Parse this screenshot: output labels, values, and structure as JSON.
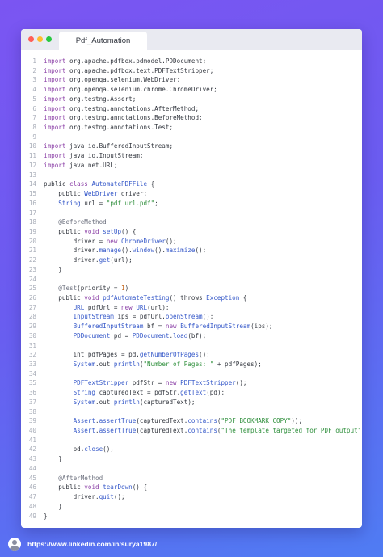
{
  "window": {
    "tab_title": "Pdf_Automation",
    "controls": [
      "close-dot",
      "minimize-dot",
      "maximize-dot"
    ]
  },
  "code": {
    "lines": [
      [
        {
          "t": "import",
          "c": "kw"
        },
        {
          "t": " org.apache.pdfbox.pdmodel.PDDocument;"
        }
      ],
      [
        {
          "t": "import",
          "c": "kw"
        },
        {
          "t": " org.apache.pdfbox.text.PDFTextStripper;"
        }
      ],
      [
        {
          "t": "import",
          "c": "kw"
        },
        {
          "t": " org.openqa.selenium.WebDriver;"
        }
      ],
      [
        {
          "t": "import",
          "c": "kw"
        },
        {
          "t": " org.openqa.selenium.chrome.ChromeDriver;"
        }
      ],
      [
        {
          "t": "import",
          "c": "kw"
        },
        {
          "t": " org.testng.Assert;"
        }
      ],
      [
        {
          "t": "import",
          "c": "kw"
        },
        {
          "t": " org.testng.annotations.AfterMethod;"
        }
      ],
      [
        {
          "t": "import",
          "c": "kw"
        },
        {
          "t": " org.testng.annotations.BeforeMethod;"
        }
      ],
      [
        {
          "t": "import",
          "c": "kw"
        },
        {
          "t": " org.testng.annotations.Test;"
        }
      ],
      [],
      [
        {
          "t": "import",
          "c": "kw"
        },
        {
          "t": " java.io.BufferedInputStream;"
        }
      ],
      [
        {
          "t": "import",
          "c": "kw"
        },
        {
          "t": " java.io.InputStream;"
        }
      ],
      [
        {
          "t": "import",
          "c": "kw"
        },
        {
          "t": " java.net.URL;"
        }
      ],
      [],
      [
        {
          "t": "public "
        },
        {
          "t": "class ",
          "c": "kw"
        },
        {
          "t": "AutomatePDFFile",
          "c": "ty"
        },
        {
          "t": " {"
        }
      ],
      [
        {
          "t": "    public "
        },
        {
          "t": "WebDriver",
          "c": "ty"
        },
        {
          "t": " driver;"
        }
      ],
      [
        {
          "t": "    "
        },
        {
          "t": "String",
          "c": "ty"
        },
        {
          "t": " url = "
        },
        {
          "t": "\"pdf url.pdf\"",
          "c": "str"
        },
        {
          "t": ";"
        }
      ],
      [],
      [
        {
          "t": "    "
        },
        {
          "t": "@BeforeMethod",
          "c": "ann"
        }
      ],
      [
        {
          "t": "    public "
        },
        {
          "t": "void ",
          "c": "kw"
        },
        {
          "t": "setUp",
          "c": "fn"
        },
        {
          "t": "() {"
        }
      ],
      [
        {
          "t": "        driver = "
        },
        {
          "t": "new ",
          "c": "kw"
        },
        {
          "t": "ChromeDriver",
          "c": "ty"
        },
        {
          "t": "();"
        }
      ],
      [
        {
          "t": "        driver."
        },
        {
          "t": "manage",
          "c": "fn"
        },
        {
          "t": "()."
        },
        {
          "t": "window",
          "c": "fn"
        },
        {
          "t": "()."
        },
        {
          "t": "maximize",
          "c": "fn"
        },
        {
          "t": "();"
        }
      ],
      [
        {
          "t": "        driver."
        },
        {
          "t": "get",
          "c": "fn"
        },
        {
          "t": "(url);"
        }
      ],
      [
        {
          "t": "    }"
        }
      ],
      [],
      [
        {
          "t": "    "
        },
        {
          "t": "@Test",
          "c": "ann"
        },
        {
          "t": "(priority = "
        },
        {
          "t": "1",
          "c": "num"
        },
        {
          "t": ")"
        }
      ],
      [
        {
          "t": "    public "
        },
        {
          "t": "void ",
          "c": "kw"
        },
        {
          "t": "pdfAutomateTesting",
          "c": "fn"
        },
        {
          "t": "() throws "
        },
        {
          "t": "Exception",
          "c": "ty"
        },
        {
          "t": " {"
        }
      ],
      [
        {
          "t": "        "
        },
        {
          "t": "URL",
          "c": "ty"
        },
        {
          "t": " pdfUrl = "
        },
        {
          "t": "new ",
          "c": "kw"
        },
        {
          "t": "URL",
          "c": "ty"
        },
        {
          "t": "(url);"
        }
      ],
      [
        {
          "t": "        "
        },
        {
          "t": "InputStream",
          "c": "ty"
        },
        {
          "t": " ips = pdfUrl."
        },
        {
          "t": "openStream",
          "c": "fn"
        },
        {
          "t": "();"
        }
      ],
      [
        {
          "t": "        "
        },
        {
          "t": "BufferedInputStream",
          "c": "ty"
        },
        {
          "t": " bf = "
        },
        {
          "t": "new ",
          "c": "kw"
        },
        {
          "t": "BufferedInputStream",
          "c": "ty"
        },
        {
          "t": "(ips);"
        }
      ],
      [
        {
          "t": "        "
        },
        {
          "t": "PDDocument",
          "c": "ty"
        },
        {
          "t": " pd = "
        },
        {
          "t": "PDDocument",
          "c": "ty"
        },
        {
          "t": "."
        },
        {
          "t": "load",
          "c": "fn"
        },
        {
          "t": "(bf);"
        }
      ],
      [],
      [
        {
          "t": "        int pdfPages = pd."
        },
        {
          "t": "getNumberOfPages",
          "c": "fn"
        },
        {
          "t": "();"
        }
      ],
      [
        {
          "t": "        "
        },
        {
          "t": "System",
          "c": "ty"
        },
        {
          "t": ".out."
        },
        {
          "t": "println",
          "c": "fn"
        },
        {
          "t": "("
        },
        {
          "t": "\"Number of Pages: \"",
          "c": "str"
        },
        {
          "t": " + pdfPages);"
        }
      ],
      [],
      [
        {
          "t": "        "
        },
        {
          "t": "PDFTextStripper",
          "c": "ty"
        },
        {
          "t": " pdfStr = "
        },
        {
          "t": "new ",
          "c": "kw"
        },
        {
          "t": "PDFTextStripper",
          "c": "ty"
        },
        {
          "t": "();"
        }
      ],
      [
        {
          "t": "        "
        },
        {
          "t": "String",
          "c": "ty"
        },
        {
          "t": " capturedText = pdfStr."
        },
        {
          "t": "getText",
          "c": "fn"
        },
        {
          "t": "(pd);"
        }
      ],
      [
        {
          "t": "        "
        },
        {
          "t": "System",
          "c": "ty"
        },
        {
          "t": ".out."
        },
        {
          "t": "println",
          "c": "fn"
        },
        {
          "t": "(capturedText);"
        }
      ],
      [],
      [
        {
          "t": "        "
        },
        {
          "t": "Assert",
          "c": "ty"
        },
        {
          "t": "."
        },
        {
          "t": "assertTrue",
          "c": "fn"
        },
        {
          "t": "(capturedText."
        },
        {
          "t": "contains",
          "c": "fn"
        },
        {
          "t": "("
        },
        {
          "t": "\"PDF BOOKMARK COPY\"",
          "c": "str"
        },
        {
          "t": "));"
        }
      ],
      [
        {
          "t": "        "
        },
        {
          "t": "Assert",
          "c": "ty"
        },
        {
          "t": "."
        },
        {
          "t": "assertTrue",
          "c": "fn"
        },
        {
          "t": "(capturedText."
        },
        {
          "t": "contains",
          "c": "fn"
        },
        {
          "t": "("
        },
        {
          "t": "\"The template targeted for PDF output\"",
          "c": "str"
        },
        {
          "t": "));"
        }
      ],
      [],
      [
        {
          "t": "        pd."
        },
        {
          "t": "close",
          "c": "fn"
        },
        {
          "t": "();"
        }
      ],
      [
        {
          "t": "    }"
        }
      ],
      [],
      [
        {
          "t": "    "
        },
        {
          "t": "@AfterMethod",
          "c": "ann"
        }
      ],
      [
        {
          "t": "    public "
        },
        {
          "t": "void ",
          "c": "kw"
        },
        {
          "t": "tearDown",
          "c": "fn"
        },
        {
          "t": "() {"
        }
      ],
      [
        {
          "t": "        driver."
        },
        {
          "t": "quit",
          "c": "fn"
        },
        {
          "t": "();"
        }
      ],
      [
        {
          "t": "    }"
        }
      ],
      [
        {
          "t": "}"
        }
      ]
    ]
  },
  "footer": {
    "avatar_icon": "user-avatar-icon",
    "link": "https://www.linkedin.com/in/surya1987/"
  }
}
